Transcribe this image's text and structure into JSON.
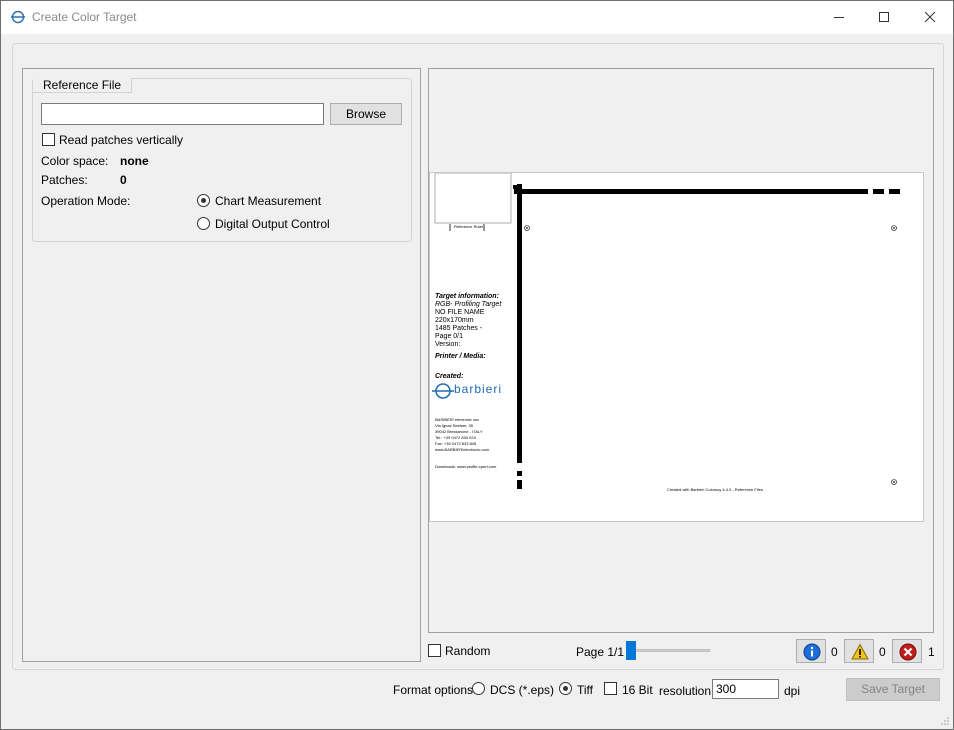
{
  "window": {
    "title": "Create Color Target",
    "minimize_icon": "minimize-icon",
    "maximize_icon": "maximize-icon",
    "close_icon": "close-icon"
  },
  "reference_file": {
    "group_label": "Reference File",
    "path_value": "",
    "browse_label": "Browse",
    "read_vertically_label": "Read patches vertically",
    "read_vertically_checked": false,
    "color_space_label": "Color space:",
    "color_space_value": "none",
    "patches_label": "Patches:",
    "patches_value": "0",
    "operation_mode_label": "Operation Mode:",
    "modes": [
      {
        "label": "Chart Measurement",
        "selected": true
      },
      {
        "label": "Digital Output Control",
        "selected": false
      }
    ]
  },
  "preview": {
    "reference_fiducial_label": "Reference Ruler",
    "target_info_heading": "Target information:",
    "target_lines": [
      "RGB- Profiling Target",
      "NO FILE NAME",
      "220x170mm",
      "1485 Patches -",
      "Page 0/1",
      "Version:"
    ],
    "printer_media_heading": "Printer / Media:",
    "created_heading": "Created:",
    "logo_text": "barbieri",
    "address_lines": [
      "BARBIERI electronic snc",
      "Via Ignaz Seidner, 35",
      "39042 Bressanone - ITALY",
      "Tel.: +39 0472 834 024",
      "Fax: +39 0472 833 845",
      "www.BARBIERIelectronic.com"
    ],
    "downloads_line": "Downloads: www.profile-xpert.com",
    "footer_line": "Created with Barbieri Colorsoy 4.4.0 - Reference Files"
  },
  "controls": {
    "random_label": "Random",
    "random_checked": false,
    "page_label": "Page 1/1",
    "page_slider_fraction": 0.0,
    "info_icon": "info-icon",
    "info_count": "0",
    "warning_icon": "warning-icon",
    "warning_count": "0",
    "error_icon": "error-icon",
    "error_count": "1"
  },
  "format": {
    "label": "Format options",
    "options": [
      {
        "label": "DCS (*.eps)",
        "selected": false
      },
      {
        "label": "Tiff",
        "selected": true
      }
    ],
    "bit16_label": "16 Bit",
    "bit16_checked": false,
    "resolution_label": "resolution",
    "resolution_value": "300",
    "dpi_label": "dpi",
    "save_label": "Save Target"
  },
  "colors": {
    "accent": "#0078d7",
    "info_blue": "#1e6fd9",
    "warning_yellow": "#f4c21a",
    "error_red": "#c41d1d"
  }
}
